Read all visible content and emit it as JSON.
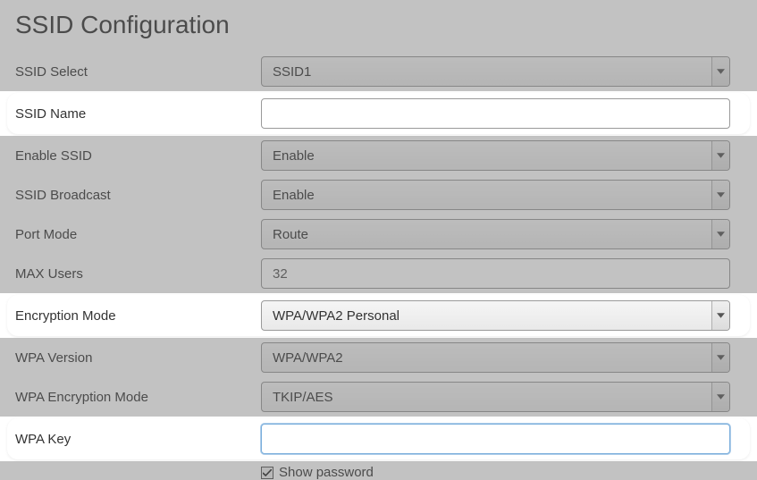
{
  "title": "SSID Configuration",
  "rows": {
    "ssid_select": {
      "label": "SSID Select",
      "value": "SSID1"
    },
    "ssid_name": {
      "label": "SSID Name",
      "value": ""
    },
    "enable_ssid": {
      "label": "Enable SSID",
      "value": "Enable"
    },
    "ssid_broadcast": {
      "label": "SSID Broadcast",
      "value": "Enable"
    },
    "port_mode": {
      "label": "Port Mode",
      "value": "Route"
    },
    "max_users": {
      "label": "MAX Users",
      "value": "32"
    },
    "encryption_mode": {
      "label": "Encryption Mode",
      "value": "WPA/WPA2 Personal"
    },
    "wpa_version": {
      "label": "WPA Version",
      "value": "WPA/WPA2"
    },
    "wpa_enc_mode": {
      "label": "WPA Encryption Mode",
      "value": "TKIP/AES"
    },
    "wpa_key": {
      "label": "WPA Key",
      "value": ""
    }
  },
  "show_password": {
    "label": "Show password",
    "checked": true
  }
}
